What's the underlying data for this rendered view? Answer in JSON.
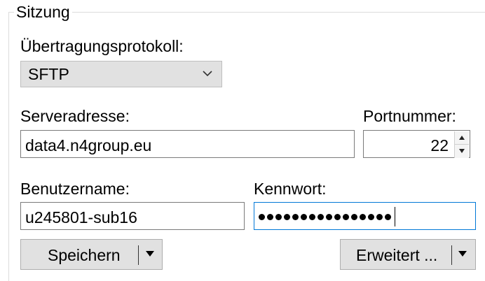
{
  "session": {
    "group_title": "Sitzung",
    "protocol": {
      "label": "Übertragungsprotokoll:",
      "selected": "SFTP",
      "icon": "chevron-down-icon"
    },
    "server": {
      "label": "Serveradresse:",
      "value": "data4.n4group.eu"
    },
    "port": {
      "label": "Portnummer:",
      "value": "22",
      "icon": "spin-up-down-icon"
    },
    "username": {
      "label": "Benutzername:",
      "value": "u245801-sub16"
    },
    "password": {
      "label": "Kennwort:",
      "masked_length": 16
    },
    "buttons": {
      "save_label": "Speichern",
      "advanced_label": "Erweitert ..."
    }
  },
  "colors": {
    "focus_border": "#0078d7",
    "button_bg": "#e1e1e1",
    "input_border": "#7a7a7a"
  }
}
